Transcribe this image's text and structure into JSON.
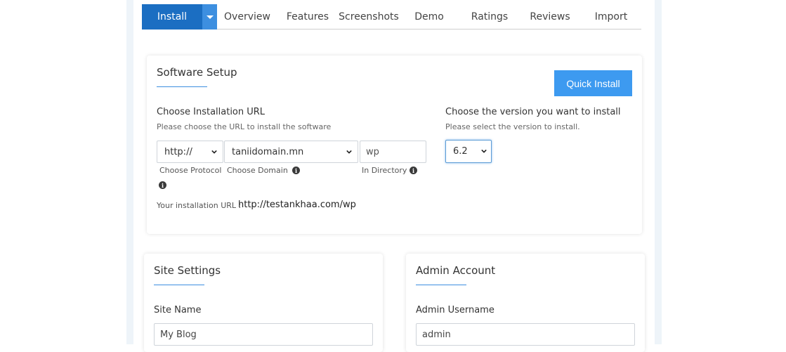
{
  "tabs": {
    "install": "Install",
    "items": [
      "Overview",
      "Features",
      "Screenshots",
      "Demo",
      "Ratings",
      "Reviews",
      "Import"
    ]
  },
  "software_setup": {
    "title": "Software Setup",
    "quick_install": "Quick Install",
    "url_label": "Choose Installation URL",
    "url_help": "Please choose the URL to install the software",
    "protocol_value": "http://",
    "domain_value": "taniidomain.mn",
    "directory_value": "wp",
    "protocol_caption": "Choose Protocol",
    "domain_caption": "Choose Domain",
    "directory_caption": "In Directory",
    "install_url_label": "Your installation URL :",
    "install_url_value": "http://testankhaa.com/wp",
    "version_label": "Choose the version you want to install",
    "version_help": "Please select the version to install.",
    "version_value": "6.2"
  },
  "site_settings": {
    "title": "Site Settings",
    "site_name_label": "Site Name",
    "site_name_value": "My Blog"
  },
  "admin_account": {
    "title": "Admin Account",
    "username_label": "Admin Username",
    "username_value": "admin"
  },
  "colors": {
    "primary": "#1b6ec2",
    "accent": "#3d9af0"
  }
}
